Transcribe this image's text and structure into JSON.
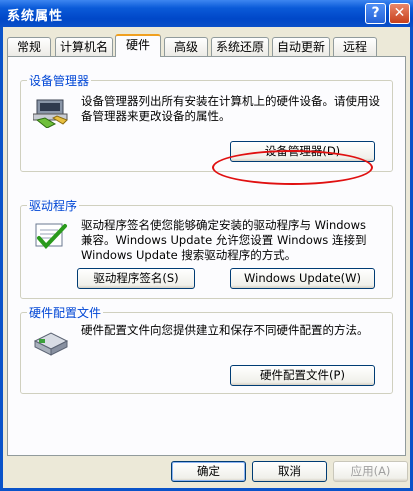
{
  "window": {
    "title": "系统属性",
    "help_glyph": "?",
    "close_glyph": "✕"
  },
  "tabs": [
    {
      "label": "常规"
    },
    {
      "label": "计算机名"
    },
    {
      "label": "硬件"
    },
    {
      "label": "高级"
    },
    {
      "label": "系统还原"
    },
    {
      "label": "自动更新"
    },
    {
      "label": "远程"
    }
  ],
  "device_manager": {
    "title": "设备管理器",
    "description": "设备管理器列出所有安装在计算机上的硬件设备。请使用设备管理器来更改设备的属性。",
    "button": "设备管理器(D)"
  },
  "drivers": {
    "title": "驱动程序",
    "description": "驱动程序签名使您能够确定安装的驱动程序与 Windows 兼容。Windows Update 允许您设置 Windows 连接到 Windows Update 搜索驱动程序的方式。",
    "signing_button": "驱动程序签名(S)",
    "update_button": "Windows Update(W)"
  },
  "hardware_profiles": {
    "title": "硬件配置文件",
    "description": "硬件配置文件向您提供建立和保存不同硬件配置的方法。",
    "button": "硬件配置文件(P)"
  },
  "footer": {
    "ok": "确定",
    "cancel": "取消",
    "apply": "应用(A)"
  }
}
